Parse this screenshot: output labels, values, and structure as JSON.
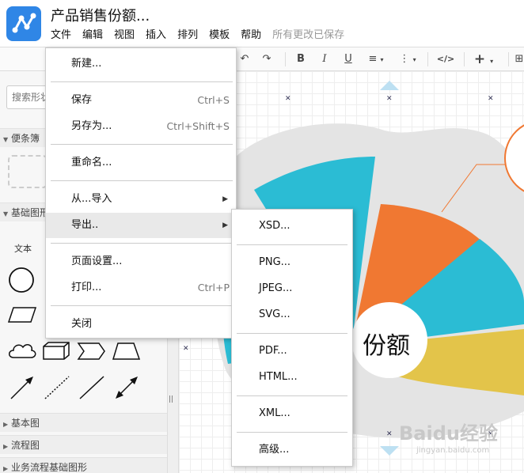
{
  "app": {
    "doc_title": "产品销售份额...",
    "saved_status": "所有更改已保存"
  },
  "menubar": [
    "文件",
    "编辑",
    "视图",
    "插入",
    "排列",
    "模板",
    "帮助"
  ],
  "sidebar": {
    "search_placeholder": "搜索形状",
    "sections": {
      "scratchpad": "便条簿",
      "basic_shapes": "基础图形",
      "basic_diagram": "基本图",
      "flowchart": "流程图",
      "bpmn_basic": "业务流程基础图形"
    },
    "text_label": "文本"
  },
  "file_menu": {
    "new": "新建...",
    "save": "保存",
    "save_shortcut": "Ctrl+S",
    "save_as": "另存为...",
    "save_as_shortcut": "Ctrl+Shift+S",
    "rename": "重命名...",
    "import_from": "从...导入",
    "export": "导出..",
    "page_setup": "页面设置...",
    "print": "打印...",
    "print_shortcut": "Ctrl+P",
    "close": "关闭"
  },
  "export_menu": {
    "xsd": "XSD...",
    "png": "PNG...",
    "jpeg": "JPEG...",
    "svg": "SVG...",
    "pdf": "PDF...",
    "html": "HTML...",
    "xml": "XML...",
    "advanced": "高级..."
  },
  "canvas": {
    "center_label": "份额",
    "watermark": "Baidu经验",
    "watermark_url": "jingyan.baidu.com"
  },
  "colors": {
    "cyan": "#2bbcd4",
    "orange": "#f07832",
    "yellow": "#e3c44a",
    "map_gray": "#e4e4e4",
    "logo_blue": "#2f86e6"
  }
}
